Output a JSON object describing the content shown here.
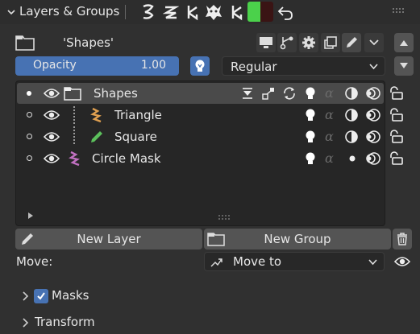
{
  "header": {
    "title": "Layers & Groups",
    "menu_icon": "chevron-down-icon",
    "icons": [
      "hook-s-icon",
      "zigzag-icon",
      "k-icon",
      "monster-icon",
      "k-icon",
      "color-swatch-icon",
      "undo-arrow-icon"
    ]
  },
  "properties": {
    "layer_name": "'Shapes'",
    "icons": [
      "monitor-icon",
      "node-tree-icon",
      "gear-icon",
      "copy-icon",
      "pencil-icon",
      "chevron-down-icon"
    ]
  },
  "opacity": {
    "label": "Opacity",
    "value": "1.00"
  },
  "blend": {
    "value": "Regular"
  },
  "layers": [
    {
      "name": "Shapes",
      "type": "group",
      "selected": true
    },
    {
      "name": "Triangle",
      "type": "layer",
      "icon_color": "#e0a050"
    },
    {
      "name": "Square",
      "type": "layer",
      "icon_color": "#5cc05c"
    },
    {
      "name": "Circle Mask",
      "type": "mask",
      "icon_color": "#c070c0"
    }
  ],
  "buttons": {
    "new_layer": "New Layer",
    "new_group": "New Group"
  },
  "move": {
    "label": "Move:",
    "value": "Move to"
  },
  "panels": {
    "masks": {
      "label": "Masks",
      "checked": true
    },
    "transform": {
      "label": "Transform"
    }
  },
  "colors": {
    "accent": "#4772b3",
    "background": "#303030",
    "list_bg": "#262626"
  }
}
